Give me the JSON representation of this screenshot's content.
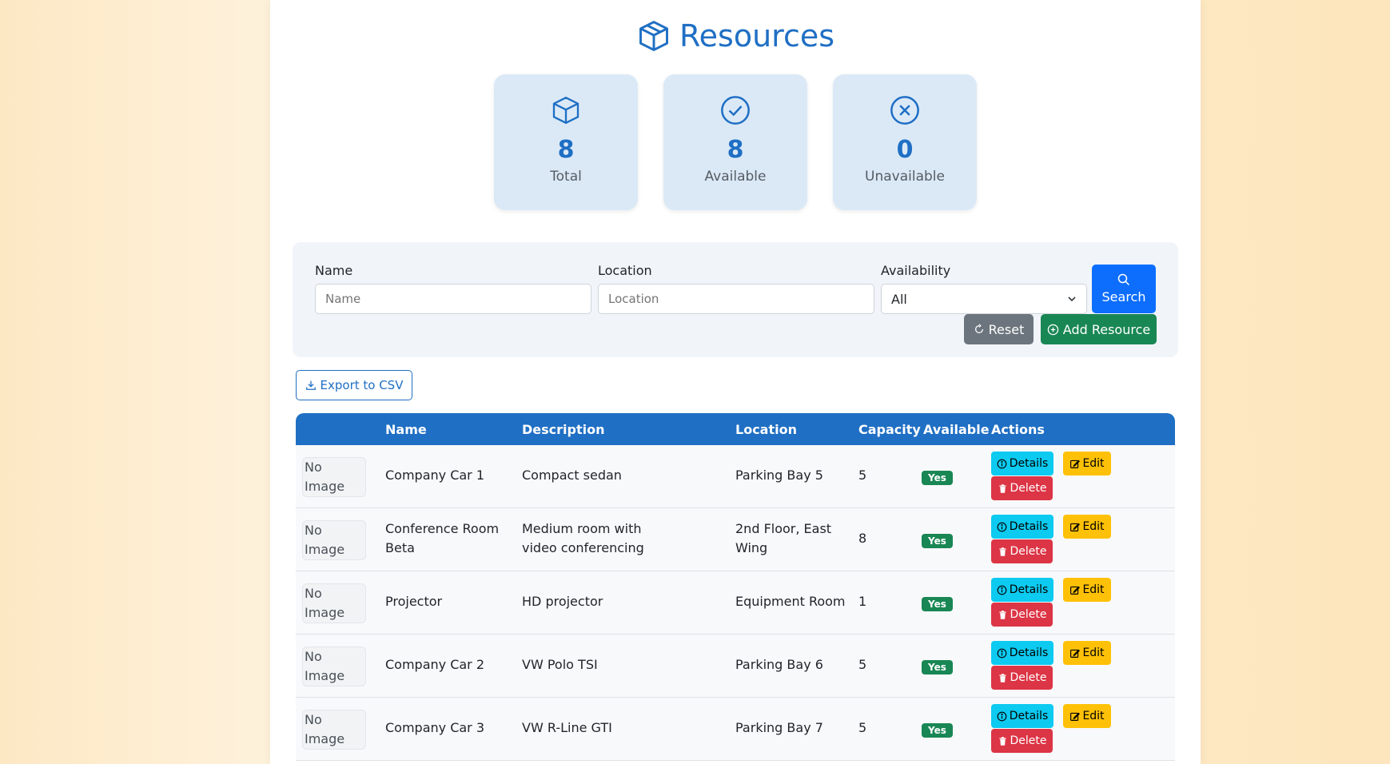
{
  "header": {
    "title": "Resources"
  },
  "stats": [
    {
      "icon": "box-icon",
      "value": "8",
      "label": "Total"
    },
    {
      "icon": "check-circle-icon",
      "value": "8",
      "label": "Available"
    },
    {
      "icon": "x-circle-icon",
      "value": "0",
      "label": "Unavailable"
    }
  ],
  "filters": {
    "name_label": "Name",
    "name_placeholder": "Name",
    "location_label": "Location",
    "location_placeholder": "Location",
    "availability_label": "Availability",
    "availability_value": "All",
    "search_label": "Search",
    "reset_label": "Reset",
    "add_label": "Add Resource"
  },
  "export_label": "Export to CSV",
  "table": {
    "headers": [
      "",
      "Name",
      "Description",
      "Location",
      "Capacity",
      "Available",
      "Actions"
    ],
    "image_alt": "No Image",
    "details_label": "Details",
    "edit_label": "Edit",
    "delete_label": "Delete",
    "rows": [
      {
        "name": "Company Car 1",
        "description": "Compact sedan",
        "location": "Parking Bay 5",
        "capacity": "5",
        "available": "Yes"
      },
      {
        "name": "Conference Room Beta",
        "description": "Medium room with video conferencing",
        "location": "2nd Floor, East Wing",
        "capacity": "8",
        "available": "Yes"
      },
      {
        "name": "Projector",
        "description": "HD projector",
        "location": "Equipment Room",
        "capacity": "1",
        "available": "Yes"
      },
      {
        "name": "Company Car 2",
        "description": "VW Polo TSI",
        "location": "Parking Bay 6",
        "capacity": "5",
        "available": "Yes"
      },
      {
        "name": "Company Car 3",
        "description": "VW R-Line GTI",
        "location": "Parking Bay 7",
        "capacity": "5",
        "available": "Yes"
      }
    ]
  },
  "colors": {
    "primary": "#1f6fc4",
    "success": "#198754",
    "info": "#0dcaf0",
    "warning": "#ffc107",
    "danger": "#dc3545"
  }
}
